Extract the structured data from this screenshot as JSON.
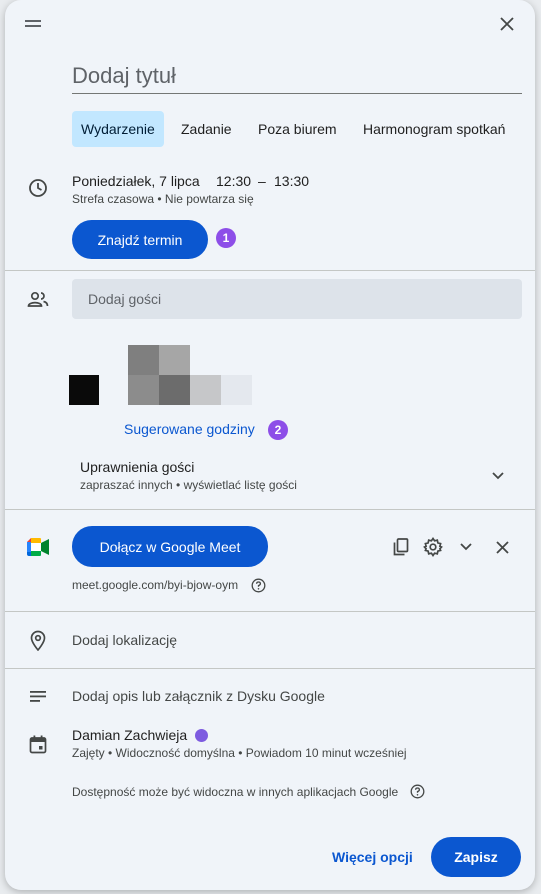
{
  "title_placeholder": "Dodaj tytuł",
  "tabs": [
    {
      "label": "Wydarzenie",
      "active": true
    },
    {
      "label": "Zadanie"
    },
    {
      "label": "Poza biurem"
    },
    {
      "label": "Harmonogram spotkań"
    }
  ],
  "time": {
    "date": "Poniedziałek, 7 lipca",
    "start": "12:30",
    "dash": "–",
    "end": "13:30",
    "details": "Strefa czasowa • Nie powtarza się"
  },
  "find_time": {
    "label": "Znajdź termin",
    "badge": "1"
  },
  "guests": {
    "placeholder": "Dodaj gości",
    "suggested": {
      "label": "Sugerowane godziny",
      "badge": "2"
    },
    "permissions_title": "Uprawnienia gości",
    "permissions_detail": "zapraszać innych • wyświetlać listę gości"
  },
  "meet": {
    "button_label": "Dołącz w Google Meet",
    "link": "meet.google.com/byi-bjow-oym"
  },
  "location_label": "Dodaj lokalizację",
  "description_label": "Dodaj opis lub załącznik z Dysku Google",
  "calendar": {
    "owner": "Damian Zachwieja",
    "owner_color": "#7d5be0",
    "details": "Zajęty • Widoczność domyślna • Powiadom 10 minut wcześniej"
  },
  "availability_note": "Dostępność może być widoczna w innych aplikacjach Google",
  "footer": {
    "more_options": "Więcej opcji",
    "save": "Zapisz"
  },
  "colors": {
    "primary": "#0b57d0",
    "badge": "#8d4ee8",
    "active_tab": "#c2e7ff"
  }
}
